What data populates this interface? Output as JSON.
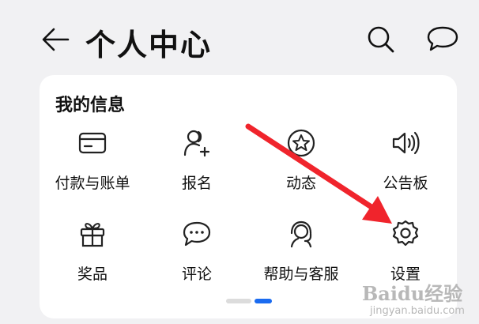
{
  "header": {
    "title": "个人中心"
  },
  "card": {
    "title": "我的信息",
    "items": [
      {
        "label": "付款与账单",
        "icon": "card-icon"
      },
      {
        "label": "报名",
        "icon": "add-user-icon"
      },
      {
        "label": "动态",
        "icon": "star-circle-icon"
      },
      {
        "label": "公告板",
        "icon": "speaker-icon"
      },
      {
        "label": "奖品",
        "icon": "gift-icon"
      },
      {
        "label": "评论",
        "icon": "comment-icon"
      },
      {
        "label": "帮助与客服",
        "icon": "headset-icon"
      },
      {
        "label": "设置",
        "icon": "gear-icon"
      }
    ],
    "page_indicator": {
      "pages": 2,
      "current": 2
    }
  },
  "watermark": {
    "text": "Baidu经验",
    "url": "jingyan.baidu.com"
  },
  "colors": {
    "accent": "#1a6bf0",
    "annotation_arrow": "#f0242c",
    "card": "#ffffff",
    "background": "#f1f1f3"
  }
}
